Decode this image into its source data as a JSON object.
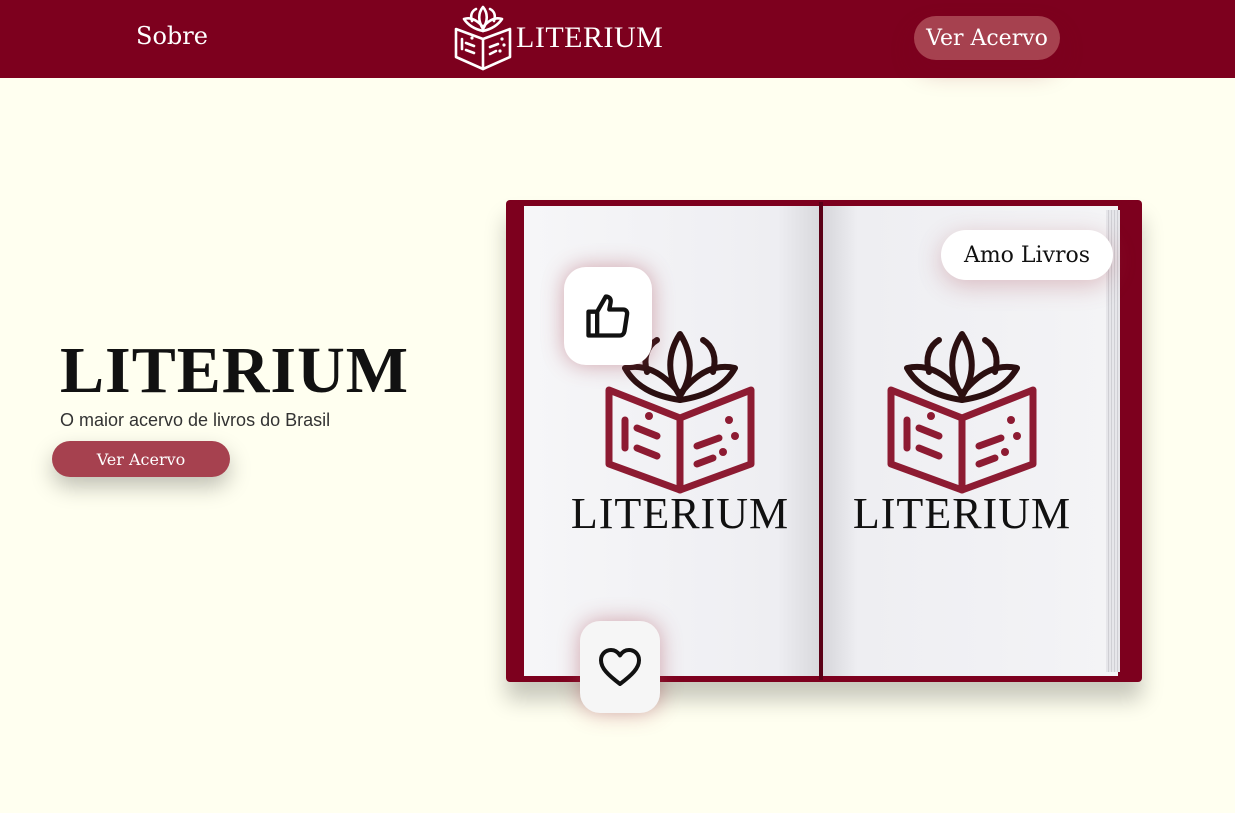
{
  "nav": {
    "about_label": "Sobre",
    "brand_name": "LITERIUM",
    "cta_label": "Ver Acervo"
  },
  "hero": {
    "title": "LITERIUM",
    "subtitle": "O maior acervo de livros do Brasil",
    "cta_label": "Ver Acervo"
  },
  "book": {
    "left_page_logo_text": "LITERIUM",
    "right_page_logo_text": "LITERIUM",
    "tag_label": "Amo Livros"
  },
  "icons": {
    "logo": "open-book-leaves-icon",
    "thumb": "thumbs-up-icon",
    "heart": "heart-icon"
  },
  "colors": {
    "brand": "#7d001e",
    "accent": "#a6414f",
    "background": "#fffff0"
  }
}
